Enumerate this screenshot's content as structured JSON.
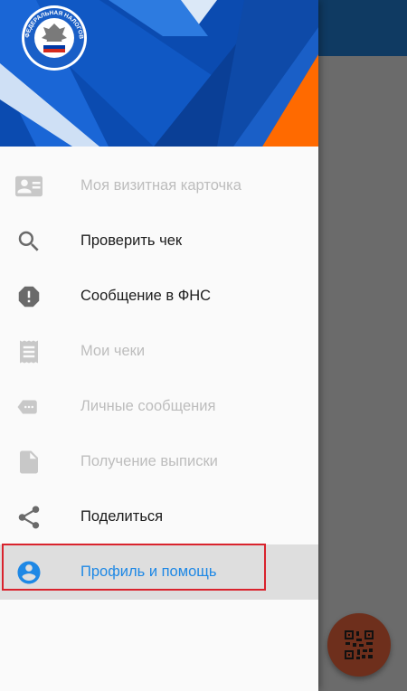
{
  "drawer": {
    "header_logo_text": "ФЕДЕРАЛЬНАЯ НАЛОГОВАЯ СЛУЖБА",
    "items": [
      {
        "label": "Моя визитная карточка",
        "icon": "contact-card-icon",
        "state": "disabled"
      },
      {
        "label": "Проверить чек",
        "icon": "search-icon",
        "state": "enabled"
      },
      {
        "label": "Сообщение в ФНС",
        "icon": "alert-octagon-icon",
        "state": "enabled"
      },
      {
        "label": "Мои чеки",
        "icon": "receipt-icon",
        "state": "disabled"
      },
      {
        "label": "Личные сообщения",
        "icon": "label-tag-icon",
        "state": "disabled"
      },
      {
        "label": "Получение выписки",
        "icon": "document-icon",
        "state": "disabled"
      },
      {
        "label": "Поделиться",
        "icon": "share-icon",
        "state": "enabled"
      },
      {
        "label": "Профиль и помощь",
        "icon": "account-circle-icon",
        "state": "active"
      }
    ]
  },
  "fab": {
    "icon": "qr-code-icon"
  },
  "colors": {
    "header_blue": "#0b4bb0",
    "accent_orange": "#ff6a00",
    "active_blue": "#1e88e5",
    "highlight_red": "#d9232d",
    "fab_bg": "#6e2f1c"
  }
}
